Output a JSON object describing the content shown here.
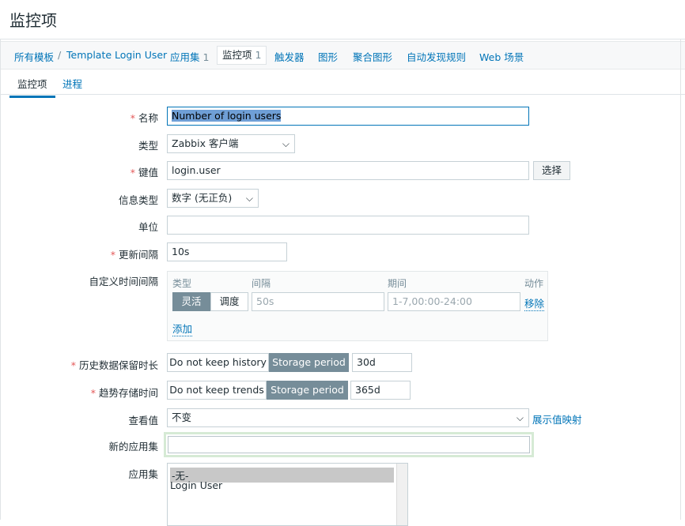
{
  "page": {
    "title": "监控项"
  },
  "breadcrumb": {
    "all_templates": "所有模板",
    "separator": "/",
    "template": "Template Login User"
  },
  "nav": {
    "applications_label": "应用集",
    "applications_count": "1",
    "items_label": "监控项",
    "items_count": "1",
    "triggers": "触发器",
    "graphs": "图形",
    "screens": "聚合图形",
    "discovery": "自动发现规则",
    "web": "Web 场景"
  },
  "tabs": {
    "item": "监控项",
    "process": "进程"
  },
  "form": {
    "required_mark": "*",
    "name_label": "名称",
    "name_value": "Number of login users",
    "type_label": "类型",
    "type_value": "Zabbix 客户端",
    "key_label": "键值",
    "key_value": "login.user",
    "key_select_button": "选择",
    "info_type_label": "信息类型",
    "info_type_value": "数字 (无正负)",
    "units_label": "单位",
    "units_value": "",
    "update_interval_label": "更新间隔",
    "update_interval_value": "10s",
    "custom_intervals_label": "自定义时间间隔",
    "custom_intervals": {
      "col_type": "类型",
      "col_interval": "间隔",
      "col_period": "期间",
      "col_action": "动作",
      "flexible": "灵活",
      "scheduling": "调度",
      "interval_placeholder": "50s",
      "period_placeholder": "1-7,00:00-24:00",
      "remove": "移除",
      "add": "添加"
    },
    "history_label": "历史数据保留时长",
    "history_no_keep": "Do not keep history",
    "history_storage": "Storage period",
    "history_value": "30d",
    "trends_label": "趋势存储时间",
    "trends_no_keep": "Do not keep trends",
    "trends_storage": "Storage period",
    "trends_value": "365d",
    "show_value_label": "查看值",
    "show_value_value": "不变",
    "show_value_mappings": "展示值映射",
    "new_application_label": "新的应用集",
    "new_application_value": "",
    "applications_label": "应用集",
    "applications_options": [
      "-无-",
      "Login User"
    ]
  }
}
